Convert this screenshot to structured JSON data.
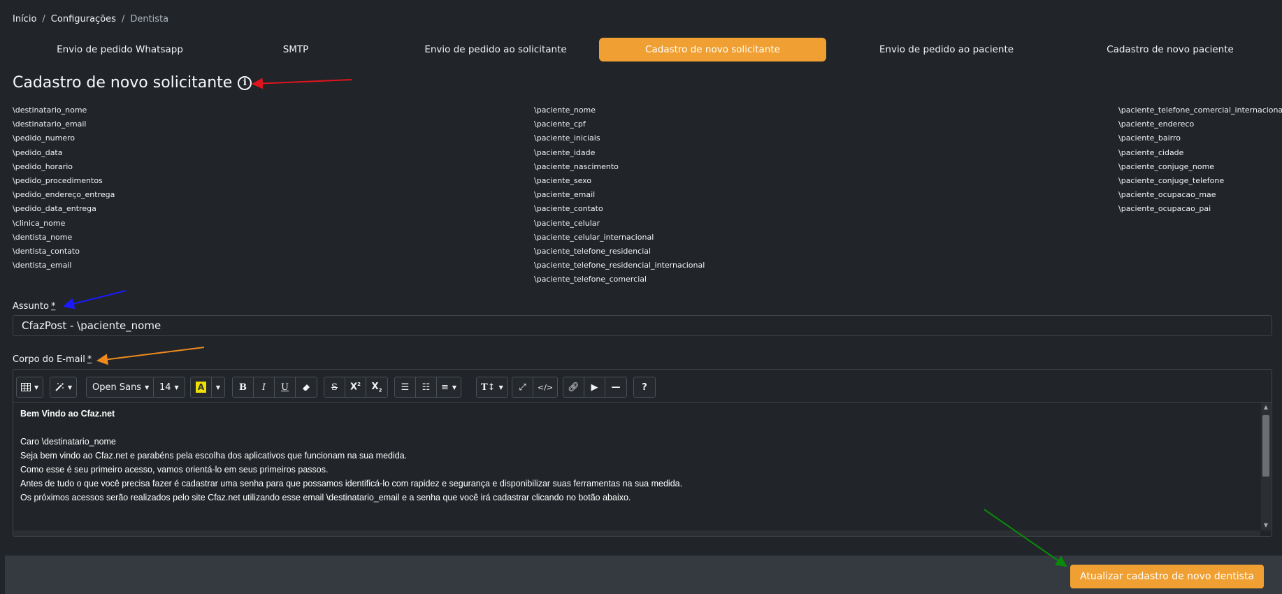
{
  "breadcrumb": {
    "home": "Início",
    "settings": "Configurações",
    "current": "Dentista",
    "separator": "/"
  },
  "tabs": [
    {
      "label": "Envio de pedido Whatsapp"
    },
    {
      "label": "SMTP"
    },
    {
      "label": "Envio de pedido ao solicitante"
    },
    {
      "label": "Cadastro de novo solicitante",
      "active": true
    },
    {
      "label": "Envio de pedido ao paciente"
    },
    {
      "label": "Cadastro de novo paciente"
    }
  ],
  "page_title": "Cadastro de novo solicitante",
  "variables": {
    "col1": [
      "\\destinatario_nome",
      "\\destinatario_email",
      "\\pedido_numero",
      "\\pedido_data",
      "\\pedido_horario",
      "\\pedido_procedimentos",
      "\\pedido_endereço_entrega",
      "\\pedido_data_entrega",
      "\\clinica_nome",
      "\\dentista_nome",
      "\\dentista_contato",
      "\\dentista_email"
    ],
    "col2": [
      "\\paciente_nome",
      "\\paciente_cpf",
      "\\paciente_iniciais",
      "\\paciente_idade",
      "\\paciente_nascimento",
      "\\paciente_sexo",
      "\\paciente_email",
      "\\paciente_contato",
      "\\paciente_celular",
      "\\paciente_celular_internacional",
      "\\paciente_telefone_residencial",
      "\\paciente_telefone_residencial_internacional",
      "\\paciente_telefone_comercial"
    ],
    "col3": [
      "\\paciente_telefone_comercial_internacional",
      "\\paciente_endereco",
      "\\paciente_bairro",
      "\\paciente_cidade",
      "\\paciente_conjuge_nome",
      "\\paciente_conjuge_telefone",
      "\\paciente_ocupacao_mae",
      "\\paciente_ocupacao_pai"
    ]
  },
  "subject": {
    "label": "Assunto",
    "required_mark": "*",
    "value": "CfazPost - \\paciente_nome"
  },
  "body": {
    "label": "Corpo do E-mail",
    "required_mark": "*",
    "toolbar": {
      "font_family": "Open Sans",
      "font_size": "14",
      "highlight_letter": "A"
    },
    "lines": [
      "Bem Vindo ao Cfaz.net",
      "",
      "Caro \\destinatario_nome",
      "Seja bem vindo ao Cfaz.net e parabéns pela escolha dos aplicativos que funcionam na sua medida.",
      "Como esse é seu primeiro acesso, vamos orientá-lo em seus primeiros passos.",
      "Antes de tudo o que você precisa fazer é cadastrar uma senha para que possamos identificá-lo com rapidez e segurança e disponibilizar suas ferramentas na sua medida.",
      "Os próximos acessos serão realizados pelo site Cfaz.net utilizando esse email \\destinatario_email e a senha que você irá cadastrar clicando no botão abaixo."
    ]
  },
  "save_button": "Atualizar cadastro de novo dentista",
  "colors": {
    "accent": "#f0a032",
    "background": "#212529",
    "footer": "#343a40"
  },
  "annotation_arrows": [
    {
      "name": "red-arrow",
      "color": "#e0141e"
    },
    {
      "name": "blue-arrow",
      "color": "#1a1aff"
    },
    {
      "name": "orange-arrow",
      "color": "#f08a1e"
    },
    {
      "name": "green-arrow",
      "color": "#0a8a0a"
    }
  ]
}
